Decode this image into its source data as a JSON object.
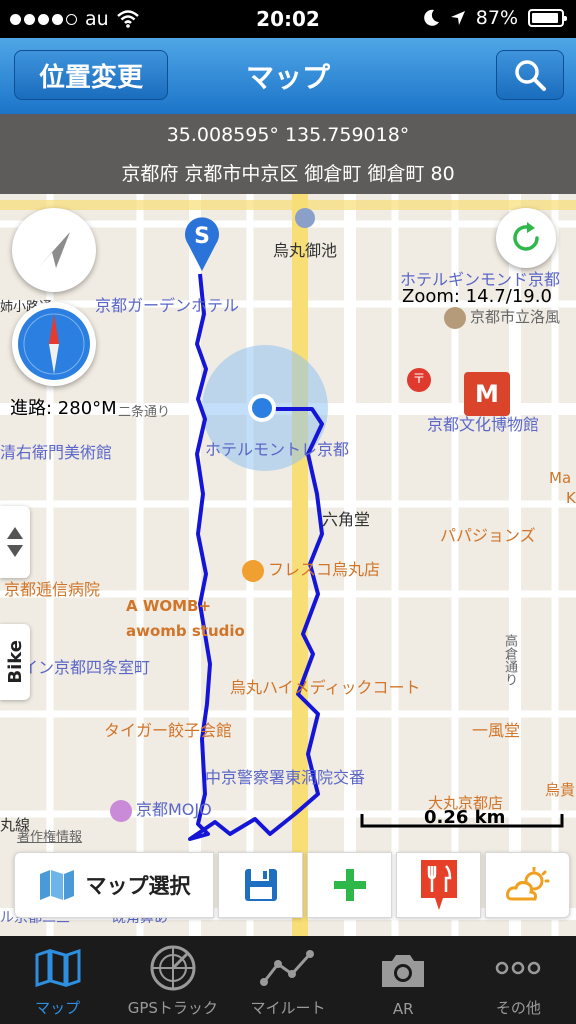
{
  "status": {
    "carrier": "au",
    "time": "20:02",
    "battery": "87%"
  },
  "nav": {
    "left_button": "位置変更",
    "title": "マップ",
    "right_icon": "search-icon"
  },
  "info": {
    "coords": "35.008595° 135.759018°",
    "address": "京都府 京都市中京区 御倉町 御倉町 80"
  },
  "map": {
    "zoom": "Zoom: 14.7/19.0",
    "heading": "進路: 280°M",
    "scale": "0.26 km",
    "copyright": "著作権情報",
    "bike_tab": "Bike",
    "start_marker": "S",
    "pois": {
      "karasuma_oike": "烏丸御池",
      "hotel_gimmond": "ホテルギンモンド京都",
      "kyoto_garden_hotel": "京都ガーデンホテル",
      "rakuyo": "京都市立洛風",
      "museum": "京都文化博物館",
      "nijo": "二条通り",
      "monterey": "ホテルモントレ京都",
      "art_museum": "清右衛門美術館",
      "rokkakudo": "六角堂",
      "papajohns": "パパジョンズ",
      "fresco": "フレスコ烏丸店",
      "teishin": "京都逓信病院",
      "awomb1": "A WOMB+",
      "awomb2": "awomb studio",
      "inn": "イン京都四条室町",
      "medic": "烏丸ハイメディックコート",
      "takakura": "高倉通り",
      "tiger": "タイガー餃子会館",
      "ippudo": "一風堂",
      "koban": "中京警察署東洞院交番",
      "mojo": "京都MOJO",
      "daimaru": "大丸京都店",
      "karasuma_line": "丸線",
      "edge_ma": "Ma",
      "edge_k": "K",
      "edge_oogi": "烏貴",
      "edge_nishi": "姉小路通",
      "edge_bottom": "ル京都二三",
      "edge_bottom2": "既角鼻あ"
    }
  },
  "toolbar": {
    "map_select": "マップ選択"
  },
  "tabs": [
    {
      "label": "マップ",
      "icon": "map-icon"
    },
    {
      "label": "GPSトラック",
      "icon": "radar-icon"
    },
    {
      "label": "マイルート",
      "icon": "route-icon"
    },
    {
      "label": "AR",
      "icon": "camera-icon"
    },
    {
      "label": "その他",
      "icon": "more-icon"
    }
  ],
  "colors": {
    "accent": "#1c74c9",
    "track": "#1515d8",
    "tab_active": "#2e8fe0"
  }
}
